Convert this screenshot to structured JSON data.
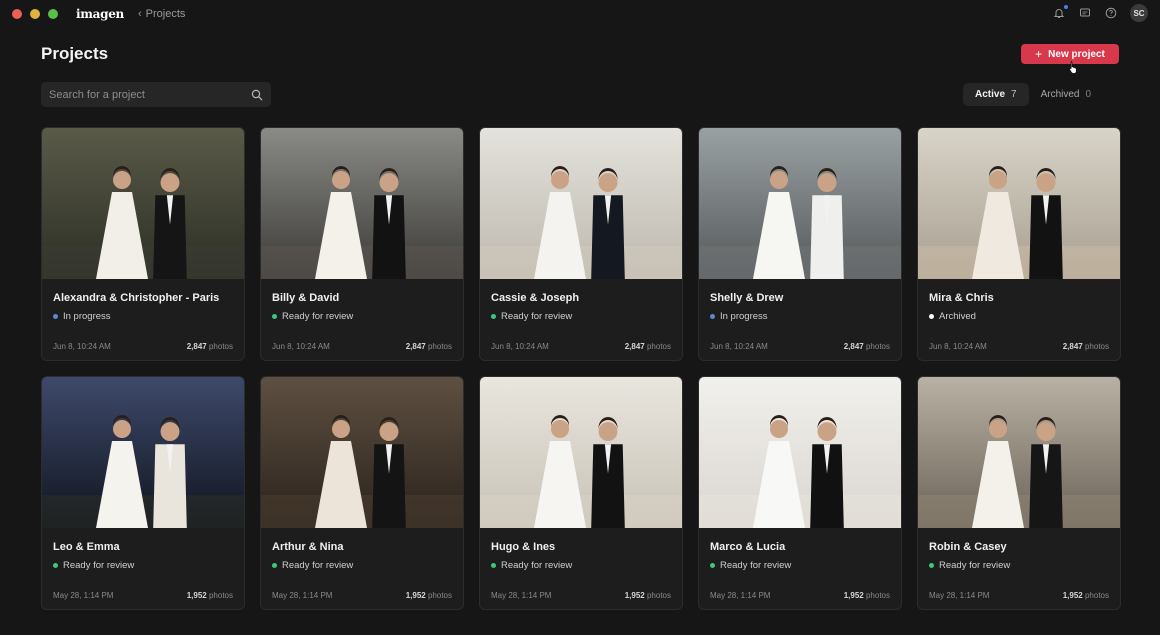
{
  "app": {
    "logo": "imagen",
    "breadcrumb": "Projects"
  },
  "titlebar_icons": [
    "bell-icon",
    "chat-icon",
    "help-icon"
  ],
  "user": {
    "initials": "SC"
  },
  "header": {
    "title": "Projects",
    "new_button": "New project"
  },
  "search": {
    "placeholder": "Search for a project"
  },
  "tabs": [
    {
      "label": "Active",
      "count": "7"
    },
    {
      "label": "Archived",
      "count": "0"
    }
  ],
  "colors": {
    "accent": "#d8384c",
    "in_progress": "#5b8bd6",
    "ready": "#3ec97a",
    "archived": "#ffffff"
  },
  "photos_label": "photos",
  "projects": [
    {
      "name": "Alexandra & Christopher - Paris",
      "status": "In progress",
      "status_type": "in_progress",
      "date": "Jun 8, 10:24 AM",
      "count": "2,847"
    },
    {
      "name": "Billy & David",
      "status": "Ready for review",
      "status_type": "ready",
      "date": "Jun 8, 10:24 AM",
      "count": "2,847"
    },
    {
      "name": "Cassie & Joseph",
      "status": "Ready for review",
      "status_type": "ready",
      "date": "Jun 8, 10:24 AM",
      "count": "2,847"
    },
    {
      "name": "Shelly & Drew",
      "status": "In progress",
      "status_type": "in_progress",
      "date": "Jun 8, 10:24 AM",
      "count": "2,847"
    },
    {
      "name": "Mira & Chris",
      "status": "Archived",
      "status_type": "archived",
      "date": "Jun 8, 10:24 AM",
      "count": "2,847"
    },
    {
      "name": "Leo & Emma",
      "status": "Ready for review",
      "status_type": "ready",
      "date": "May 28, 1:14 PM",
      "count": "1,952"
    },
    {
      "name": "Arthur & Nina",
      "status": "Ready for review",
      "status_type": "ready",
      "date": "May 28, 1:14 PM",
      "count": "1,952"
    },
    {
      "name": "Hugo & Ines",
      "status": "Ready for review",
      "status_type": "ready",
      "date": "May 28, 1:14 PM",
      "count": "1,952"
    },
    {
      "name": "Marco & Lucia",
      "status": "Ready for review",
      "status_type": "ready",
      "date": "May 28, 1:14 PM",
      "count": "1,952"
    },
    {
      "name": "Robin & Casey",
      "status": "Ready for review",
      "status_type": "ready",
      "date": "May 28, 1:14 PM",
      "count": "1,952"
    }
  ]
}
